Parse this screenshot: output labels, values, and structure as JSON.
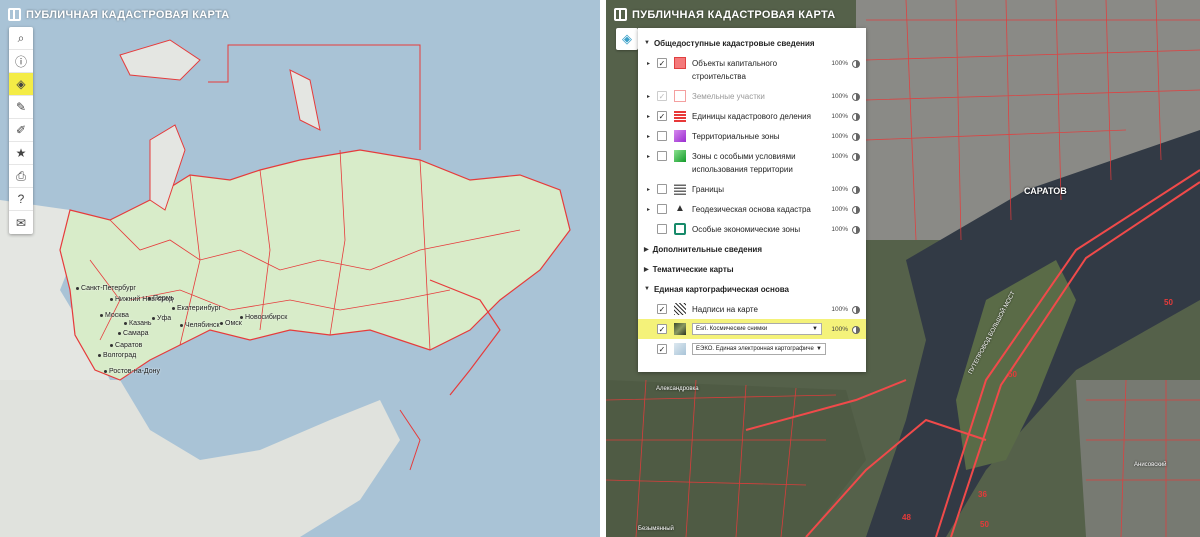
{
  "app": {
    "title": "ПУБЛИЧНАЯ КАДАСТРОВАЯ КАРТА"
  },
  "toolbar": {
    "tools": [
      {
        "name": "search-icon",
        "glyph": "⌕"
      },
      {
        "name": "info-icon",
        "glyph": "ⓘ"
      },
      {
        "name": "layers-icon",
        "glyph": "◈"
      },
      {
        "name": "pencil-icon",
        "glyph": "✎"
      },
      {
        "name": "measure-icon",
        "glyph": "✐"
      },
      {
        "name": "star-icon",
        "glyph": "★"
      },
      {
        "name": "print-icon",
        "glyph": "⎙"
      },
      {
        "name": "help-icon",
        "glyph": "?"
      },
      {
        "name": "mail-icon",
        "glyph": "✉"
      }
    ]
  },
  "left_map": {
    "cities": [
      "Санкт-Петербург",
      "Нижний Новгород",
      "Москва",
      "Казань",
      "Пермь",
      "Екатеринбург",
      "Уфа",
      "Самара",
      "Челябинск",
      "Омск",
      "Новосибирск",
      "Саратов",
      "Волгоград",
      "Ростов-на-Дону"
    ]
  },
  "right_map": {
    "labels": {
      "city": "САРАТОВ",
      "bridge": "ПУТЕПРОВОД БОЛЬШОЙ МОСТ",
      "district_1": "Александровка",
      "district_2": "Анисовский",
      "village": "Безымянный"
    },
    "numbers": [
      "50",
      "50",
      "48",
      "36",
      "50"
    ]
  },
  "layer_panel": {
    "sections": {
      "public": "Общедоступные кадастровые сведения",
      "additional": "Дополнительные сведения",
      "thematic": "Тематические карты",
      "basemap": "Единая картографическая основа"
    },
    "public_layers": [
      {
        "label": "Объекты капитального строительства",
        "checked": "✓",
        "pct": "100%",
        "color": "#f4797a"
      },
      {
        "label": "Земельные участки",
        "checked": "✓",
        "pct": "100%",
        "color": "#f4a0a0"
      },
      {
        "label": "Единицы кадастрового деления",
        "checked": "✓",
        "pct": "100%",
        "color": "#e83838"
      },
      {
        "label": "Территориальные зоны",
        "checked": "",
        "pct": "100%",
        "color": "#b04ad8"
      },
      {
        "label": "Зоны с особыми условиями использования территории",
        "checked": "",
        "pct": "100%",
        "color": "#2cc84a"
      },
      {
        "label": "Границы",
        "checked": "",
        "pct": "100%",
        "color": "#666666"
      },
      {
        "label": "Геодезическая основа кадастра",
        "checked": "",
        "pct": "100%",
        "color": "#333333"
      },
      {
        "label": "Особые экономические зоны",
        "checked": "",
        "pct": "100%",
        "color": "#178a6a"
      }
    ],
    "basemap_layers": {
      "labels_layer": {
        "label": "Надписи на карте",
        "checked": "✓",
        "pct": "100%"
      },
      "imagery": {
        "label": "Esri. Космические снимки",
        "checked": "✓",
        "pct": "100%"
      },
      "ezko": {
        "label": "ЕЭКО. Единая электронная картографиче",
        "checked": "✓"
      }
    }
  }
}
